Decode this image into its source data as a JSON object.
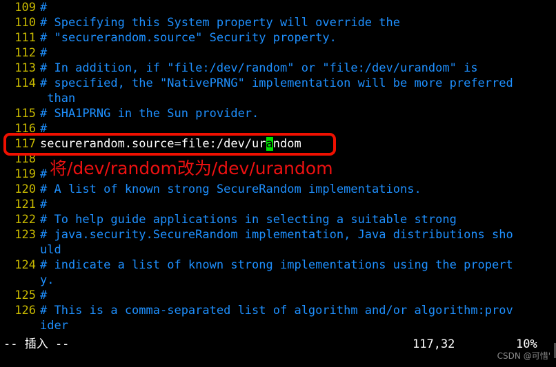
{
  "editor": {
    "name": "vim",
    "background_color": "#000000",
    "line_number_color": "#c8b900",
    "comment_color": "#1e90ff",
    "code_color": "#ffffff",
    "cursor_color": "#00e000",
    "lines": [
      {
        "number": "109",
        "text": "#",
        "kind": "comment"
      },
      {
        "number": "110",
        "text": "# Specifying this System property will override the",
        "kind": "comment"
      },
      {
        "number": "111",
        "text": "# \"securerandom.source\" Security property.",
        "kind": "comment"
      },
      {
        "number": "112",
        "text": "#",
        "kind": "comment"
      },
      {
        "number": "113",
        "text": "# In addition, if \"file:/dev/random\" or \"file:/dev/urandom\" is",
        "kind": "comment"
      },
      {
        "number": "114",
        "text": "# specified, the \"NativePRNG\" implementation will be more preferred",
        "kind": "comment"
      },
      {
        "number": "",
        "text": " than",
        "kind": "comment",
        "wrap": true
      },
      {
        "number": "115",
        "text": "# SHA1PRNG in the Sun provider.",
        "kind": "comment"
      },
      {
        "number": "116",
        "text": "#",
        "kind": "comment"
      },
      {
        "number": "117",
        "text": "securerandom.source=file:/dev/urandom",
        "kind": "code",
        "cursor_index": 32
      },
      {
        "number": "118",
        "text": "",
        "kind": "comment"
      },
      {
        "number": "119",
        "text": "#",
        "kind": "comment"
      },
      {
        "number": "120",
        "text": "# A list of known strong SecureRandom implementations.",
        "kind": "comment"
      },
      {
        "number": "121",
        "text": "#",
        "kind": "comment"
      },
      {
        "number": "122",
        "text": "# To help guide applications in selecting a suitable strong",
        "kind": "comment"
      },
      {
        "number": "123",
        "text": "# java.security.SecureRandom implementation, Java distributions sho",
        "kind": "comment"
      },
      {
        "number": "",
        "text": "uld",
        "kind": "comment",
        "wrap": true
      },
      {
        "number": "124",
        "text": "# indicate a list of known strong implementations using the propert",
        "kind": "comment"
      },
      {
        "number": "",
        "text": "y.",
        "kind": "comment",
        "wrap": true
      },
      {
        "number": "125",
        "text": "#",
        "kind": "comment"
      },
      {
        "number": "126",
        "text": "# This is a comma-separated list of algorithm and/or algorithm:prov",
        "kind": "comment"
      },
      {
        "number": "",
        "text": "ider",
        "kind": "comment",
        "wrap": true
      }
    ]
  },
  "annotation": {
    "highlight_color": "#f01000",
    "note_color": "#ee1111",
    "note_text": "将/dev/random改为/dev/urandom"
  },
  "status": {
    "mode": "-- 插入 --",
    "cursor_position": "117,32",
    "scroll_percent": "10%"
  },
  "watermark": {
    "text": "CSDN @可惜'"
  }
}
